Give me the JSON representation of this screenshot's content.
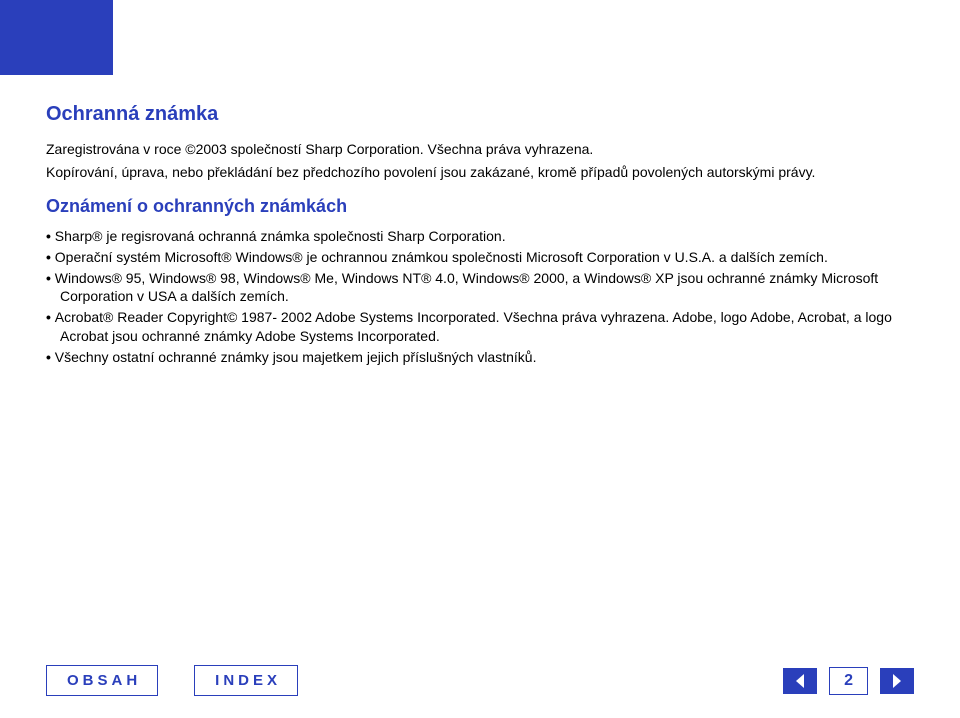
{
  "trademark": {
    "heading": "Ochranná známka",
    "registered": "Zaregistrována v roce ©2003 společností Sharp Corporation. Všechna práva vyhrazena.",
    "copying": "Kopírování, úprava, nebo překládání bez předchozího povolení jsou zakázané, kromě případů povolených autorskými právy."
  },
  "notice": {
    "heading": "Oznámení o ochranných známkách",
    "items": [
      "Sharp® je regisrovaná ochranná známka společnosti Sharp Corporation.",
      "Operační systém Microsoft® Windows® je ochrannou známkou společnosti Microsoft Corporation v U.S.A. a dalších zemích.",
      "Windows® 95, Windows® 98, Windows® Me, Windows NT® 4.0, Windows® 2000, a Windows® XP jsou ochranné známky Microsoft Corporation v USA a dalších zemích.",
      "Acrobat® Reader Copyright© 1987- 2002 Adobe Systems Incorporated. Všechna práva vyhrazena. Adobe, logo Adobe, Acrobat, a logo Acrobat jsou ochranné známky Adobe Systems Incorporated.",
      "Všechny ostatní ochranné známky jsou majetkem jejich příslušných vlastníků."
    ]
  },
  "footer": {
    "contents_label": "OBSAH",
    "index_label": "INDEX",
    "page_number": "2"
  }
}
